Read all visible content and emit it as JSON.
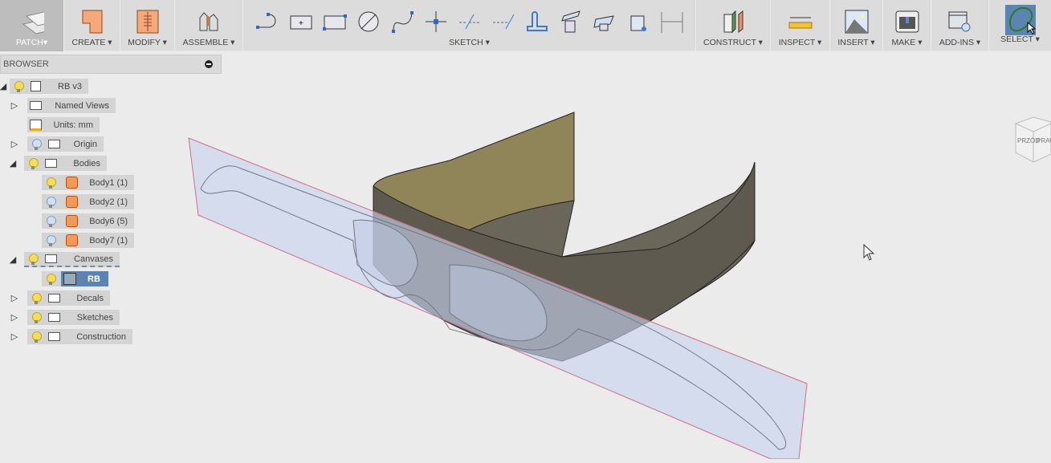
{
  "toolbar": {
    "workspace": "PATCH▾",
    "groups": [
      {
        "label": "CREATE ▾"
      },
      {
        "label": "MODIFY ▾"
      },
      {
        "label": "ASSEMBLE ▾"
      },
      {
        "label": "SKETCH ▾"
      },
      {
        "label": "CONSTRUCT ▾"
      },
      {
        "label": "INSPECT ▾"
      },
      {
        "label": "INSERT ▾"
      },
      {
        "label": "MAKE ▾"
      },
      {
        "label": "ADD-INS ▾"
      },
      {
        "label": "SELECT ▾"
      }
    ]
  },
  "browser": {
    "title": "BROWSER",
    "items": [
      {
        "label": "RB v3"
      },
      {
        "label": "Named Views"
      },
      {
        "label": "Units: mm"
      },
      {
        "label": "Origin"
      },
      {
        "label": "Bodies"
      },
      {
        "label": "Body1 (1)"
      },
      {
        "label": "Body2 (1)"
      },
      {
        "label": "Body6 (5)"
      },
      {
        "label": "Body7 (1)"
      },
      {
        "label": "Canvases"
      },
      {
        "label": "RB"
      },
      {
        "label": "Decals"
      },
      {
        "label": "Sketches"
      },
      {
        "label": "Construction"
      }
    ]
  },
  "viewcube": {
    "front": "PRZÓD",
    "right": "PRAWO"
  }
}
